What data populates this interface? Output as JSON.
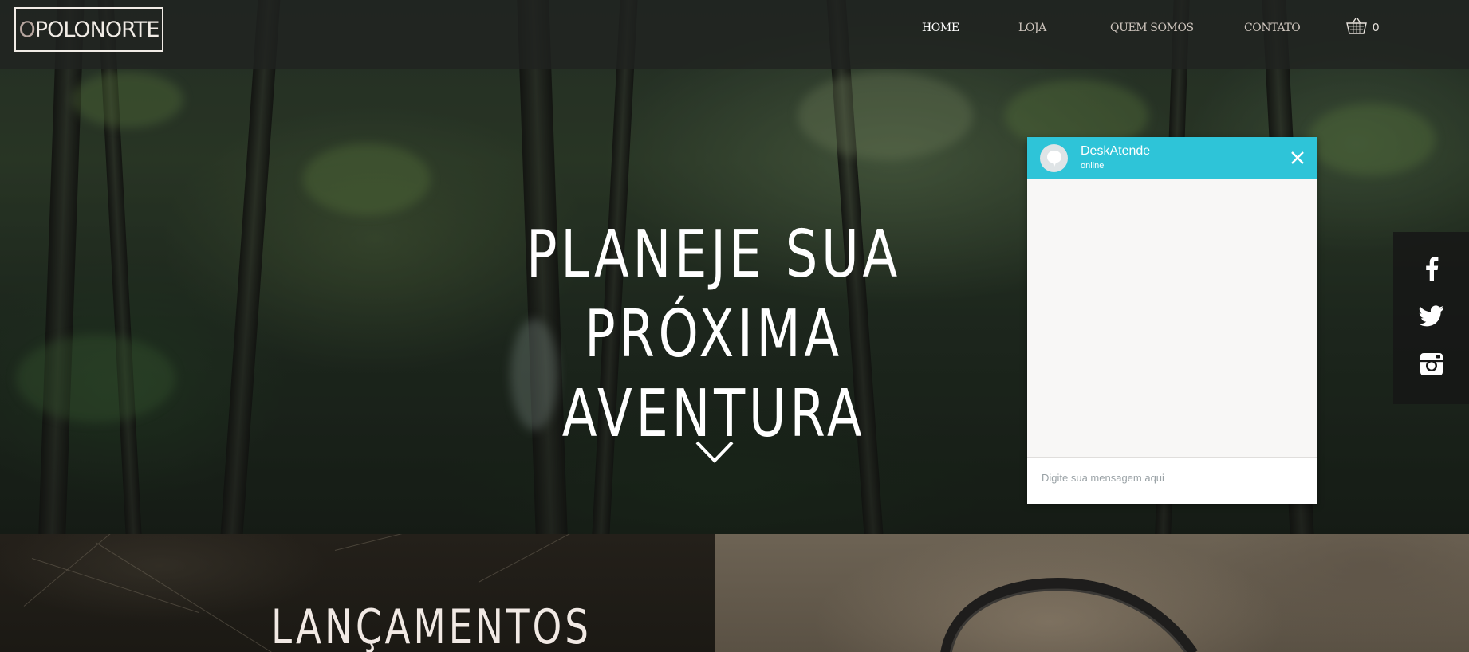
{
  "brand": {
    "logo_initial": "O",
    "logo_text": "POLONORTE"
  },
  "nav": {
    "items": [
      {
        "label": "HOME",
        "active": true
      },
      {
        "label": "LOJA",
        "active": false
      },
      {
        "label": "QUEM SOMOS",
        "active": false
      },
      {
        "label": "CONTATO",
        "active": false
      }
    ],
    "cart_icon": "basket-icon",
    "cart_count": "0"
  },
  "hero": {
    "title_line1": "PLANEJE SUA",
    "title_line2": "PRÓXIMA AVENTURA",
    "scroll_icon": "chevron-down-icon"
  },
  "chat": {
    "name": "DeskAtende",
    "status": "online",
    "input_placeholder": "Digite sua mensagem aqui",
    "header_color": "#2ec4d8",
    "close_icon": "close-icon"
  },
  "social": {
    "items": [
      {
        "icon": "facebook-icon"
      },
      {
        "icon": "twitter-icon"
      },
      {
        "icon": "instagram-icon"
      }
    ]
  },
  "sections": {
    "releases_title": "LANÇAMENTOS"
  }
}
